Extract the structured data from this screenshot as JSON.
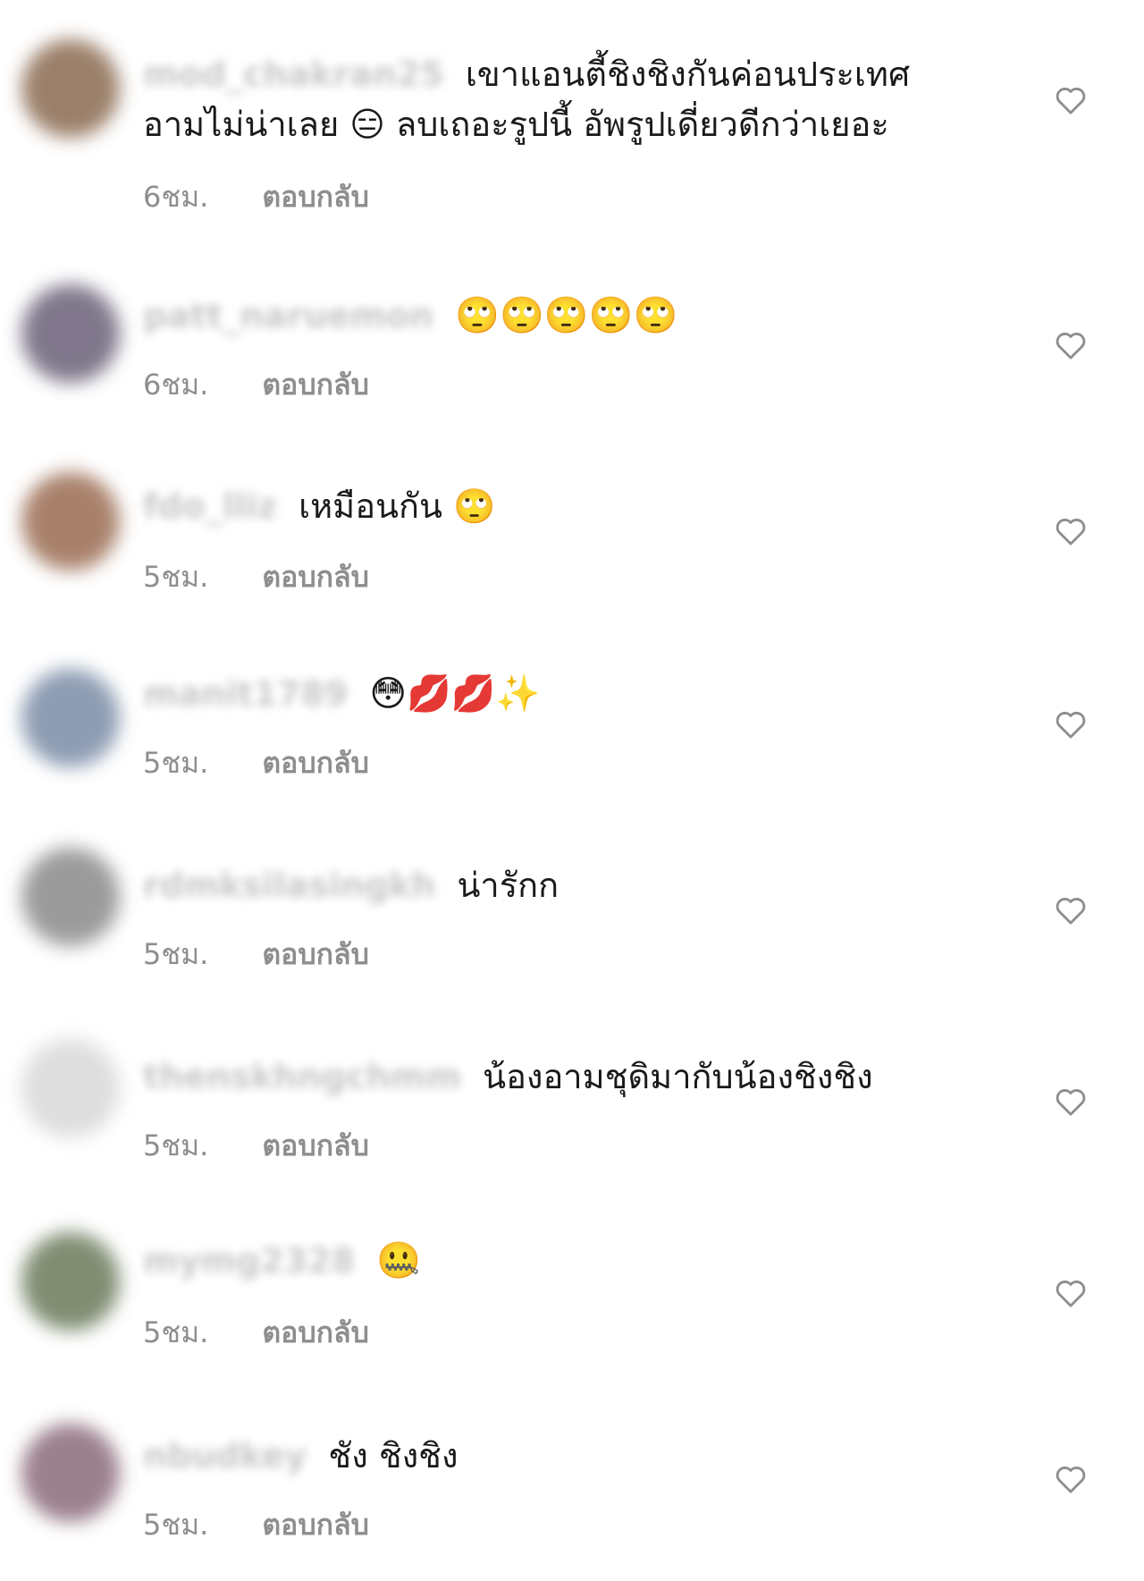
{
  "comments": [
    {
      "username": "mod_chakran25",
      "text": "เขาแอนตี้ชิงชิงกันค่อนประเทศ อามไม่น่าเลย 😑 ลบเถอะรูปนี้ อัพรูปเดี่ยวดีกว่าเยอะ",
      "time": "6ชม.",
      "reply": "ตอบกลับ",
      "avatar_color": "#8a6a50"
    },
    {
      "username": "patt_naruemon",
      "text": "🙄🙄🙄🙄🙄",
      "time": "6ชม.",
      "reply": "ตอบกลับ",
      "avatar_color": "#6a6078"
    },
    {
      "username": "fdo_lliz",
      "text": "เหมือนกัน 🙄",
      "time": "5ชม.",
      "reply": "ตอบกลับ",
      "avatar_color": "#9a6c52"
    },
    {
      "username": "manit1789",
      "text": "😳💋💋✨",
      "time": "5ชม.",
      "reply": "ตอบกลับ",
      "avatar_color": "#7a8ca6"
    },
    {
      "username": "rdmksilasingkh",
      "text": "น่ารักก",
      "time": "5ชม.",
      "reply": "ตอบกลับ",
      "avatar_color": "#8a8a8a"
    },
    {
      "username": "thenskhngchmm",
      "text": "น้องอามชุดิมากับน้องชิงชิง",
      "time": "5ชม.",
      "reply": "ตอบกลับ",
      "avatar_color": "#d8d8d8"
    },
    {
      "username": "mymg2328",
      "text": "🤐",
      "time": "5ชม.",
      "reply": "ตอบกลับ",
      "avatar_color": "#6a7a5a"
    },
    {
      "username": "nbudkey",
      "text": "ชัง ชิงชิง",
      "time": "5ชม.",
      "reply": "ตอบกลับ",
      "avatar_color": "#8a6a7a"
    }
  ],
  "icons": {
    "like": "heart-outline-icon"
  }
}
